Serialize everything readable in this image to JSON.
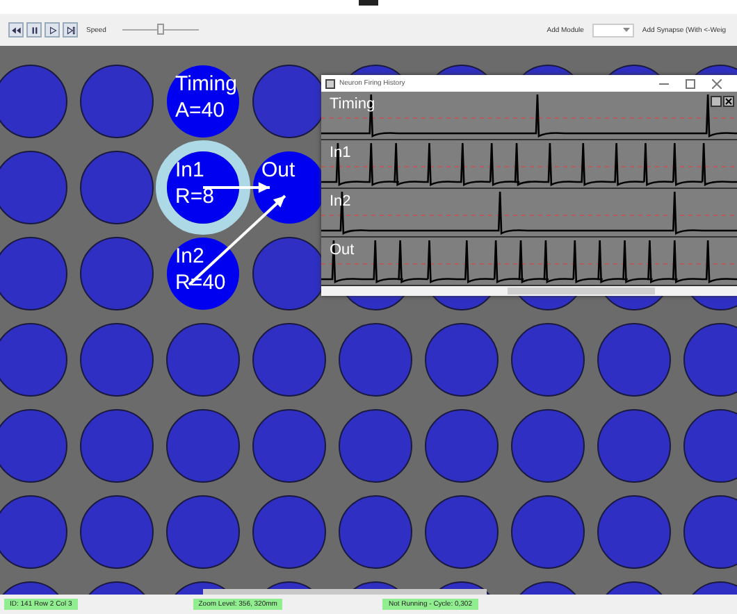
{
  "toolbar": {
    "speed_label": "Speed",
    "speed_slider": {
      "level": 0.5
    },
    "add_module_label": "Add Module",
    "add_synapse_label": "Add Synapse (With <-Weig"
  },
  "neurons": [
    {
      "name": "Timing",
      "param": "A=40",
      "selected": false
    },
    {
      "name": "In1",
      "param": "R=8",
      "selected": true
    },
    {
      "name": "Out",
      "selected": false
    },
    {
      "name": "In2",
      "param": "R=40",
      "selected": false
    }
  ],
  "history_window": {
    "title": "Neuron Firing History",
    "traces": [
      {
        "label": "Timing"
      },
      {
        "label": "In1"
      },
      {
        "label": "In2"
      },
      {
        "label": "Out"
      }
    ]
  },
  "status_bar": [
    "ID: 141  Row 2 Col 3",
    "Zoom Level: 356, 320mm",
    "Not Running - Cycle: 0,302"
  ]
}
